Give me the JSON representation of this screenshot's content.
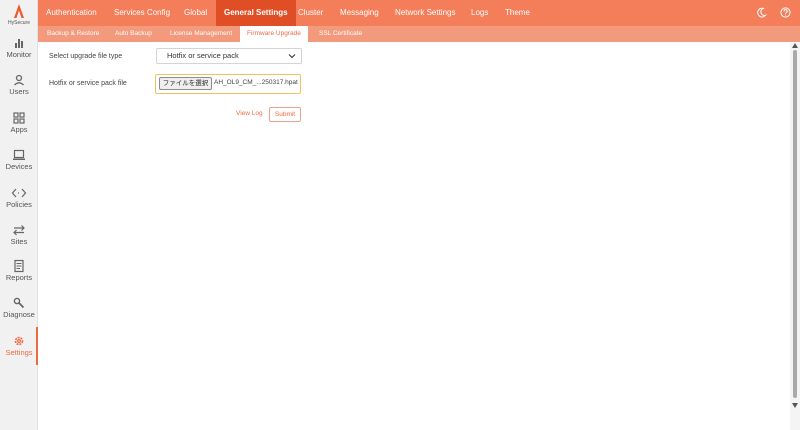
{
  "brand": {
    "name": "HySecure",
    "accent": "#ee6a45"
  },
  "sidebar": {
    "items": [
      {
        "label": "Monitor",
        "icon": "bar-chart-icon"
      },
      {
        "label": "Users",
        "icon": "user-icon"
      },
      {
        "label": "Apps",
        "icon": "apps-grid-icon"
      },
      {
        "label": "Devices",
        "icon": "laptop-icon"
      },
      {
        "label": "Policies",
        "icon": "code-arrows-icon"
      },
      {
        "label": "Sites",
        "icon": "swap-arrows-icon"
      },
      {
        "label": "Reports",
        "icon": "report-icon"
      },
      {
        "label": "Diagnose",
        "icon": "wrench-icon"
      },
      {
        "label": "Settings",
        "icon": "gear-icon",
        "active": true
      }
    ]
  },
  "topnav": {
    "tabs": [
      {
        "label": "Authentication"
      },
      {
        "label": "Services Config"
      },
      {
        "label": "Global"
      },
      {
        "label": "General Settings",
        "active": true
      },
      {
        "label": "Cluster"
      },
      {
        "label": "Messaging"
      },
      {
        "label": "Network Settings"
      },
      {
        "label": "Logs"
      },
      {
        "label": "Theme"
      }
    ],
    "icons": [
      "moon-icon",
      "help-icon"
    ]
  },
  "subnav": {
    "tabs": [
      {
        "label": "Backup & Restore"
      },
      {
        "label": "Auto Backup"
      },
      {
        "label": "License Management"
      },
      {
        "label": "Firmware Upgrade",
        "active": true
      },
      {
        "label": "SSL Certificate"
      }
    ]
  },
  "form": {
    "file_type_label": "Select upgrade file type",
    "file_type_value": "Hotfix or service pack",
    "file_label": "Hotfix or service pack file",
    "file_button": "ファイルを選択",
    "file_name": "AH_OL9_CM_...250317.hpat",
    "view_log": "View Log",
    "submit": "Submit"
  }
}
